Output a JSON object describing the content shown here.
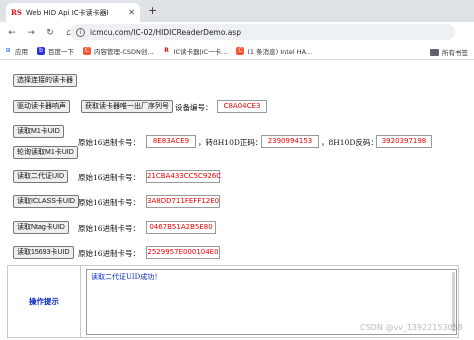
{
  "browser": {
    "tab": {
      "favicon": "RS",
      "title": "Web HID Api IC卡读卡器I",
      "close": "✕"
    },
    "new_tab": "+",
    "nav": {
      "back": "←",
      "forward": "→",
      "reload": "↻",
      "home": "⌂"
    },
    "url": "icmcu.com/IC-02/HIDICReaderDemo.asp",
    "bookmarks": [
      {
        "icon": "apps-icon",
        "label": "应用"
      },
      {
        "icon": "baidu-icon",
        "label": "百度一下"
      },
      {
        "icon": "csdn-icon",
        "label": "内容管理-CSDN创..."
      },
      {
        "icon": "rs-icon",
        "label": "IC读卡器|IC一卡..."
      },
      {
        "icon": "message-icon",
        "label": "(1 条消息) Intel HA..."
      }
    ],
    "all_bookmarks": "所有书签"
  },
  "page": {
    "select_reader": "选择连接的读卡器",
    "beep": "驱动读卡器响声",
    "get_serial": "获取读卡器唯一出厂序列号",
    "device_label": "设备编号：",
    "device_no": "C8A04CE3",
    "read_m1": "读取M1卡UID",
    "poll_m1": "轮询读取M1卡UID",
    "raw_hex_label": "原始16进制卡号：",
    "m1_hex": "8E83ACE9",
    "m1_8h10d_label": "，转8H10D正码：",
    "m1_8h10d": "2390994153",
    "m1_8h10d_rev_label": "，8H10D反码：",
    "m1_8h10d_rev": "3920397198",
    "read_id2": "读取二代证UID",
    "id2_label": "原始16进制卡号：",
    "id2_hex": "21CBA433CC5C926C",
    "read_iclass": "读取ICLASS卡UID",
    "iclass_label": "原始16进制卡号：",
    "iclass_hex": "3A8DD711FEFF12E0",
    "read_ntag": "读取Ntag卡UID",
    "ntag_label": "原始16进制卡号：",
    "ntag_hex": "0467B51A2B5E80",
    "read_15693": "读取15693卡UID",
    "iso15693_label": "原始16进制卡号：",
    "iso15693_hex": "2529957E000104E0",
    "ops_label": "操作提示",
    "ops_message": "读取二代证UID成功！"
  },
  "watermark": "CSDN @vv_13922153058"
}
